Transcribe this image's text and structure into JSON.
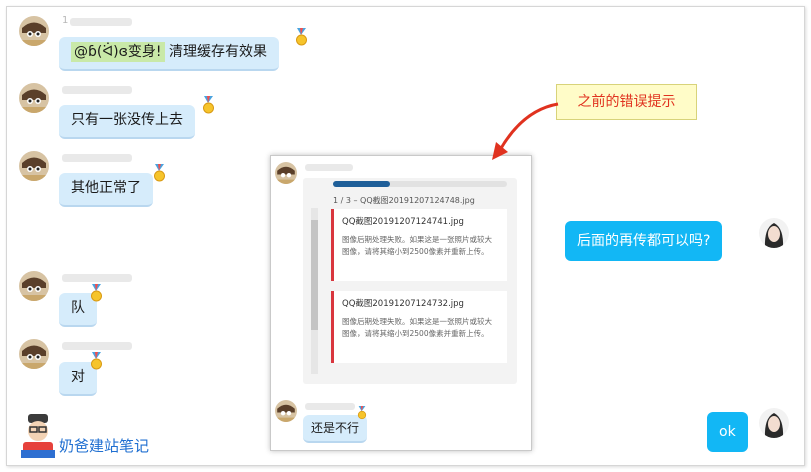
{
  "left_user_digit": "1",
  "messages_left": [
    {
      "text_prefix": "@ɓ(ᐛ)ɞ变身!",
      "text": "清理缓存有效果"
    },
    {
      "text": "只有一张没传上去"
    },
    {
      "text": "其他正常了"
    },
    {
      "text": "队"
    },
    {
      "text": "对"
    }
  ],
  "messages_right": [
    {
      "text": "后面的再传都可以吗?"
    },
    {
      "text": "ok"
    }
  ],
  "embedded_screenshot": {
    "upload_progress": 0.33,
    "header": "1 / 3 – QQ截图20191207124748.jpg",
    "errors": [
      {
        "filename": "QQ截图20191207124741.jpg",
        "message": "图像后期处理失败。如果这是一张照片或较大图像，请将其缩小到2500像素并重新上传。"
      },
      {
        "filename": "QQ截图20191207124732.jpg",
        "message": "图像后期处理失败。如果这是一张照片或较大图像，请将其缩小到2500像素并重新上传。"
      }
    ],
    "reply": "还是不行"
  },
  "annotation": "之前的错误提示",
  "watermark": "奶爸建站笔记",
  "colors": {
    "accent_red": "#e0321f",
    "bubble_blue": "#12b7f5",
    "bubble_light": "#d6ecfb"
  }
}
